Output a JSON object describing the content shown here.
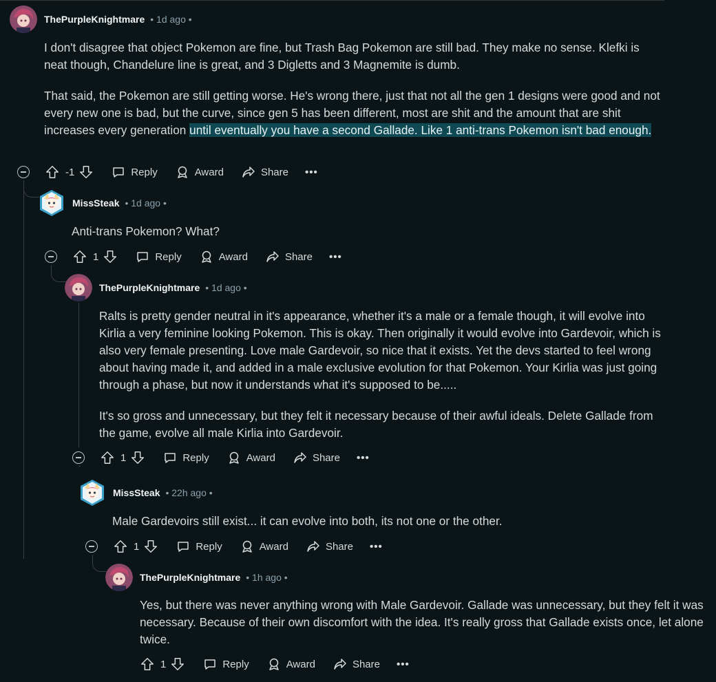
{
  "comments": [
    {
      "author": "ThePurpleKnightmare",
      "meta": "• 1d ago •",
      "paragraphs": [
        "I don't disagree that object Pokemon are fine, but Trash Bag Pokemon are still bad. They make no sense. Klefki is neat though, Chandelure line is great, and 3 Digletts and 3 Magnemite is dumb."
      ],
      "para2_plain": "That said, the Pokemon are still getting worse. He's wrong there, just that not all the gen 1 designs were good and not every new one is bad, but the curve, since gen 5 has been different, most are shit and the amount that are shit increases every generation ",
      "para2_highlight": "until eventually you have a second Gallade. Like 1 anti-trans Pokemon isn't bad enough.",
      "score": "-1"
    },
    {
      "author": "MissSteak",
      "meta": "• 1d ago •",
      "paragraphs": [
        "Anti-trans Pokemon? What?"
      ],
      "score": "1"
    },
    {
      "author": "ThePurpleKnightmare",
      "meta": "• 1d ago •",
      "paragraphs": [
        "Ralts is pretty gender neutral in it's appearance, whether it's a male or a female though, it will evolve into Kirlia a very feminine looking Pokemon. This is okay. Then originally it would evolve into Gardevoir, which is also very female presenting. Love male Gardevoir, so nice that it exists. Yet the devs started to feel wrong about having made it, and added in a male exclusive evolution for that Pokemon. Your Kirlia was just going through a phase, but now it understands what it's supposed to be.....",
        "It's so gross and unnecessary, but they felt it necessary because of their awful ideals. Delete Gallade from the game, evolve all male Kirlia into Gardevoir."
      ],
      "score": "1"
    },
    {
      "author": "MissSteak",
      "meta": "• 22h ago •",
      "paragraphs": [
        "Male Gardevoirs still exist... it can evolve into both, its not one or the other."
      ],
      "score": "1"
    },
    {
      "author": "ThePurpleKnightmare",
      "meta": "• 1h ago •",
      "paragraphs": [
        "Yes, but there was never anything wrong with Male Gardevoir. Gallade was unnecessary, but they felt it was necessary. Because of their own discomfort with the idea. It's really gross that Gallade exists once, let alone twice."
      ],
      "score": "1"
    }
  ],
  "actions": {
    "reply": "Reply",
    "award": "Award",
    "share": "Share",
    "more": "•••"
  },
  "icons": [
    "collapse-icon",
    "upvote-icon",
    "downvote-icon",
    "reply-icon",
    "award-icon",
    "share-icon",
    "more-icon"
  ],
  "colors": {
    "background": "#0b1416",
    "highlight": "#0f4a54",
    "meta": "#8ba2ad"
  }
}
